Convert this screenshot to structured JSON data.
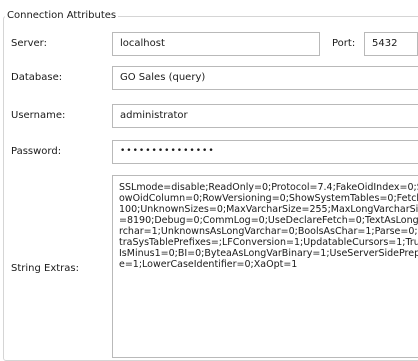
{
  "group_title": "Connection Attributes",
  "server": {
    "label": "Server:",
    "value": "localhost"
  },
  "port": {
    "label": "Port:",
    "value": "5432"
  },
  "database": {
    "label": "Database:",
    "value": "GO Sales (query)"
  },
  "username": {
    "label": "Username:",
    "value": "administrator"
  },
  "password": {
    "label": "Password:",
    "value": "•••••••••••••••"
  },
  "string_extras": {
    "label": "String Extras:",
    "value": "SSLmode=disable;ReadOnly=0;Protocol=7.4;FakeOidIndex=0;Sh\nowOidColumn=0;RowVersioning=0;ShowSystemTables=0;Fetch=\n100;UnknownSizes=0;MaxVarcharSize=255;MaxLongVarcharSize\n=8190;Debug=0;CommLog=0;UseDeclareFetch=0;TextAsLongVa\nrchar=1;UnknownsAsLongVarchar=0;BoolsAsChar=1;Parse=0;Ex\ntraSysTablePrefixes=;LFConversion=1;UpdatableCursors=1;True\nIsMinus1=0;BI=0;ByteaAsLongVarBinary=1;UseServerSidePrepar\ne=1;LowerCaseIdentifier=0;XaOpt=1"
  }
}
